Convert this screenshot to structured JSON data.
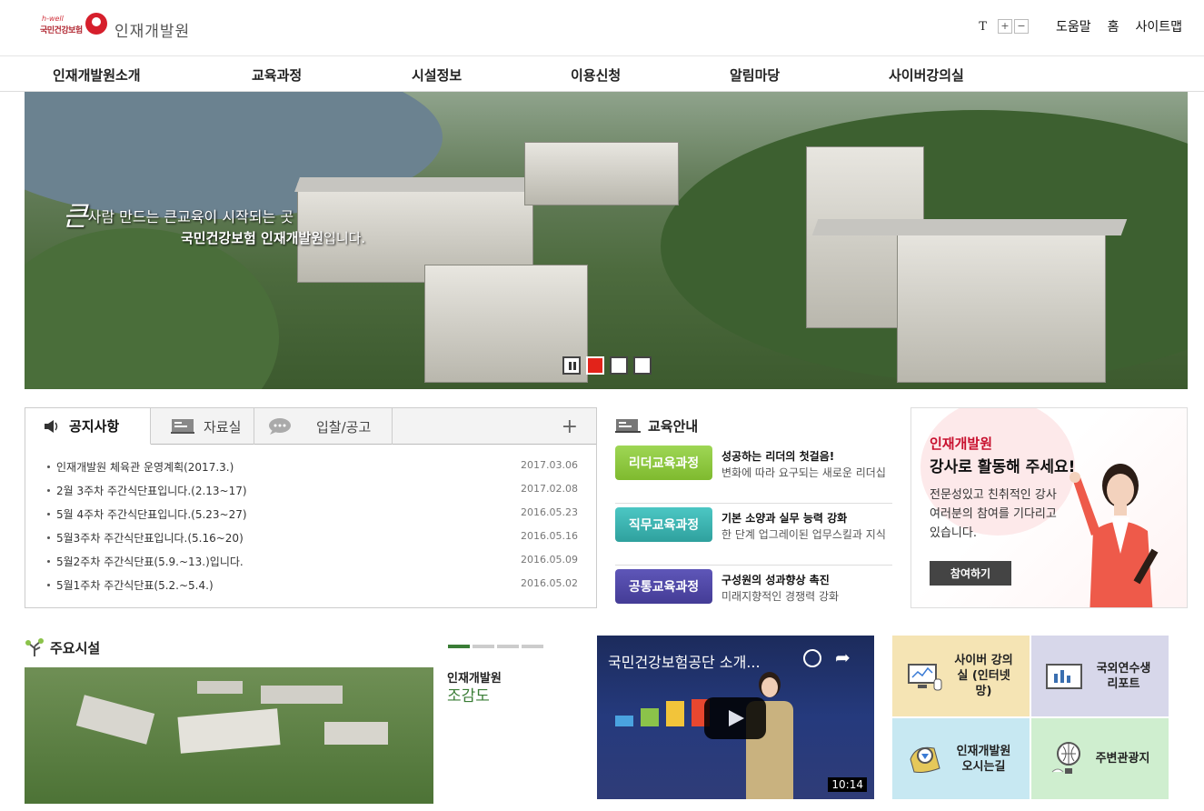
{
  "header": {
    "logo_top": "h-well",
    "logo_brand": "국민건강보험",
    "logo_title": "인재개발원",
    "font_label": "T",
    "font_plus": "+",
    "font_minus": "−",
    "help": "도움말",
    "home": "홈",
    "sitemap": "사이트맵"
  },
  "gnb": [
    "인재개발원소개",
    "교육과정",
    "시설정보",
    "이용신청",
    "알림마당",
    "사이버강의실"
  ],
  "visual": {
    "slogan_big": "큰",
    "slogan_rest": "사람 만드는 큰교육이 시작되는 곳",
    "slogan2_bold": "국민건강보험 인재개발원",
    "slogan2_rest": "입니다."
  },
  "notice": {
    "tabs": [
      {
        "label": "공지사항",
        "icon": "speaker-icon",
        "active": true
      },
      {
        "label": "자료실",
        "icon": "board-icon",
        "active": false
      },
      {
        "label": "입찰/공고",
        "icon": "speech-bubble-icon",
        "active": false
      }
    ],
    "more": "+",
    "items": [
      {
        "title": "인재개발원 체육관 운영계획(2017.3.)",
        "date": "2017.03.06"
      },
      {
        "title": "2월 3주차 주간식단표입니다.(2.13~17)",
        "date": "2017.02.08"
      },
      {
        "title": "5월 4주차 주간식단표입니다.(5.23~27)",
        "date": "2016.05.23"
      },
      {
        "title": "5월3주차 주간식단표입니다.(5.16~20)",
        "date": "2016.05.16"
      },
      {
        "title": "5월2주차 주간식단표(5.9.~13.)입니다.",
        "date": "2016.05.09"
      },
      {
        "title": "5월1주차 주간식단표(5.2.~5.4.)",
        "date": "2016.05.02"
      }
    ]
  },
  "edu": {
    "title": "교육안내",
    "items": [
      {
        "button": "리더교육과정",
        "headline": "성공하는 리더의 첫걸음!",
        "sub": "변화에 따라 요구되는 새로운 리더십",
        "color": "#8cc63f"
      },
      {
        "button": "직무교육과정",
        "headline": "기본 소양과 실무 능력 강화",
        "sub": "한 단계 업그레이된 업무스킬과 지식",
        "color": "#3bb3b0"
      },
      {
        "button": "공통교육과정",
        "headline": "구성원의 성과향상 촉진",
        "sub": "미래지향적인 경쟁력 강화",
        "color": "#4e46a6"
      }
    ]
  },
  "lecturer": {
    "line1": "인재개발원",
    "line2": "강사로 활동해 주세요!",
    "line3": "전문성있고 친취적인 강사여러분의 참여를 기다리고 있습니다.",
    "button": "참여하기"
  },
  "facility": {
    "title": "주요시설",
    "caption1": "인재개발원",
    "caption2": "조감도"
  },
  "video": {
    "title": "국민건강보험공단 소개...",
    "duration": "10:14"
  },
  "quick": [
    {
      "label": "사이버 강의실 (인터넷망)",
      "icon": "monitor-icon",
      "color": "#f5e4b4"
    },
    {
      "label": "국외연수생 리포트",
      "icon": "report-icon",
      "color": "#d7d7ea"
    },
    {
      "label": "인재개발원 오시는길",
      "icon": "map-pin-icon",
      "color": "#c7e8f2"
    },
    {
      "label": "주변관광지",
      "icon": "balloon-icon",
      "color": "#cfeecf"
    }
  ]
}
